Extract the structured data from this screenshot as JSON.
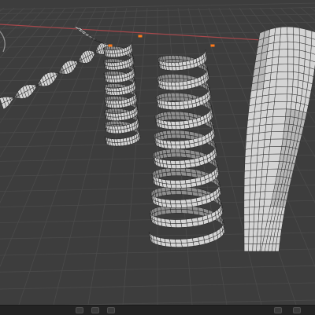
{
  "viewport": {
    "background_color": "#3d3d3d",
    "grid_color": "#4b4b4b",
    "x_axis_color": "#a8484c",
    "mesh_fill": "#d4d4d4",
    "mesh_shade": "#8e8e8e",
    "wire_color": "#222222",
    "selected_vertex_color": "#ff7a1a",
    "objects": [
      {
        "name": "twisted-ribbon-strip",
        "kind": "twist"
      },
      {
        "name": "tight-ribbon-helix",
        "kind": "helix"
      },
      {
        "name": "loose-ribbon-helix",
        "kind": "helix"
      },
      {
        "name": "swirled-sheet-mesh",
        "kind": "swirl"
      }
    ]
  },
  "statusbar": {
    "text": ""
  }
}
